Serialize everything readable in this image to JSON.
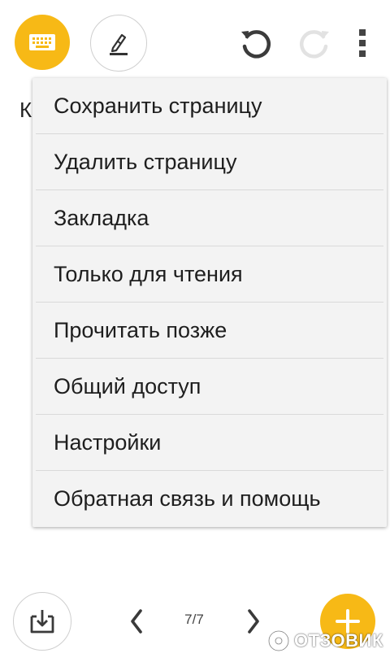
{
  "toolbar": {
    "keyboard_icon": "keyboard-icon",
    "pen_icon": "pen-icon",
    "undo_icon": "undo-icon",
    "redo_icon": "redo-icon",
    "more_icon": "more-vertical-icon",
    "accent_color": "#f7b916"
  },
  "page": {
    "first_letter": "К"
  },
  "menu": {
    "items": [
      {
        "label": "Сохранить страницу"
      },
      {
        "label": "Удалить страницу"
      },
      {
        "label": "Закладка"
      },
      {
        "label": "Только для чтения"
      },
      {
        "label": "Прочитать позже"
      },
      {
        "label": "Общий доступ"
      },
      {
        "label": "Настройки"
      },
      {
        "label": "Обратная связь и помощь"
      }
    ]
  },
  "bottom": {
    "page_counter": "7/7",
    "import_icon": "import-icon",
    "prev_icon": "chevron-left-icon",
    "next_icon": "chevron-right-icon",
    "add_icon": "plus-icon"
  },
  "watermark": {
    "text": "ОТЗОВИК"
  }
}
